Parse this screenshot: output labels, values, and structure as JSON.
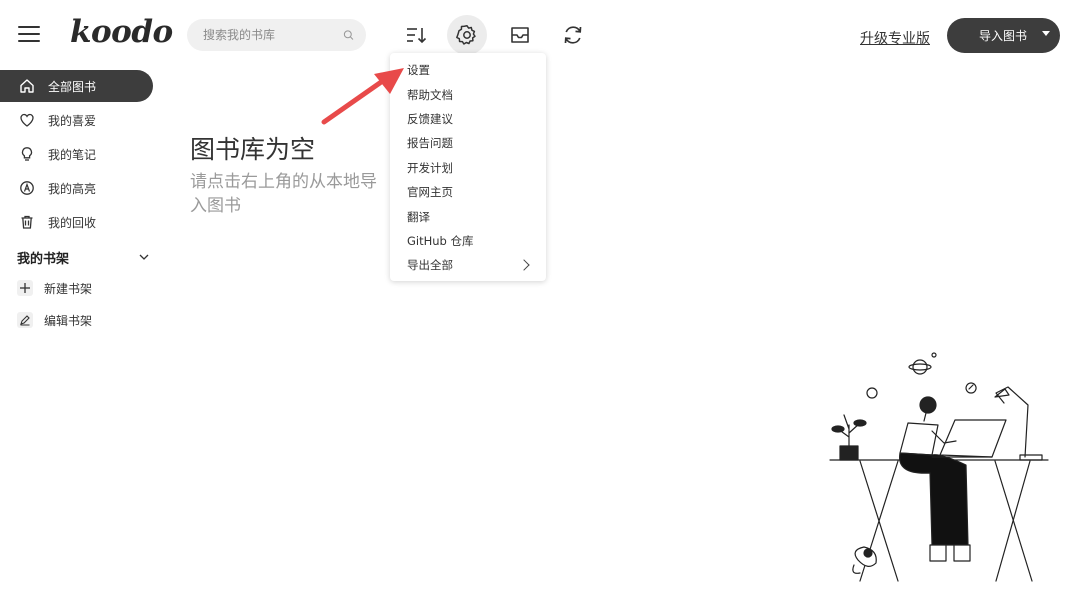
{
  "header": {
    "logo": "koodo",
    "search": {
      "placeholder": "搜索我的书库",
      "value": ""
    },
    "upgrade_label": "升级专业版",
    "import_label": "导入图书"
  },
  "sidebar": {
    "items": [
      {
        "label": "全部图书",
        "icon": "home-icon",
        "active": true
      },
      {
        "label": "我的喜爱",
        "icon": "heart-icon",
        "active": false
      },
      {
        "label": "我的笔记",
        "icon": "lightbulb-icon",
        "active": false
      },
      {
        "label": "我的高亮",
        "icon": "highlight-icon",
        "active": false
      },
      {
        "label": "我的回收",
        "icon": "trash-icon",
        "active": false
      }
    ],
    "shelf_header": "我的书架",
    "shelf_actions": [
      {
        "label": "新建书架",
        "icon": "plus-icon"
      },
      {
        "label": "编辑书架",
        "icon": "pencil-icon"
      }
    ]
  },
  "main": {
    "empty_title": "图书库为空",
    "empty_desc": "请点击右上角的从本地导入图书"
  },
  "menu": {
    "items": [
      {
        "label": "设置"
      },
      {
        "label": "帮助文档"
      },
      {
        "label": "反馈建议"
      },
      {
        "label": "报告问题"
      },
      {
        "label": "开发计划"
      },
      {
        "label": "官网主页"
      },
      {
        "label": "翻译"
      },
      {
        "label": "GitHub 仓库"
      },
      {
        "label": "导出全部",
        "has_submenu": true
      }
    ]
  },
  "colors": {
    "accent_dark": "#3d3d3d",
    "pointer_arrow": "#e84a4a"
  }
}
